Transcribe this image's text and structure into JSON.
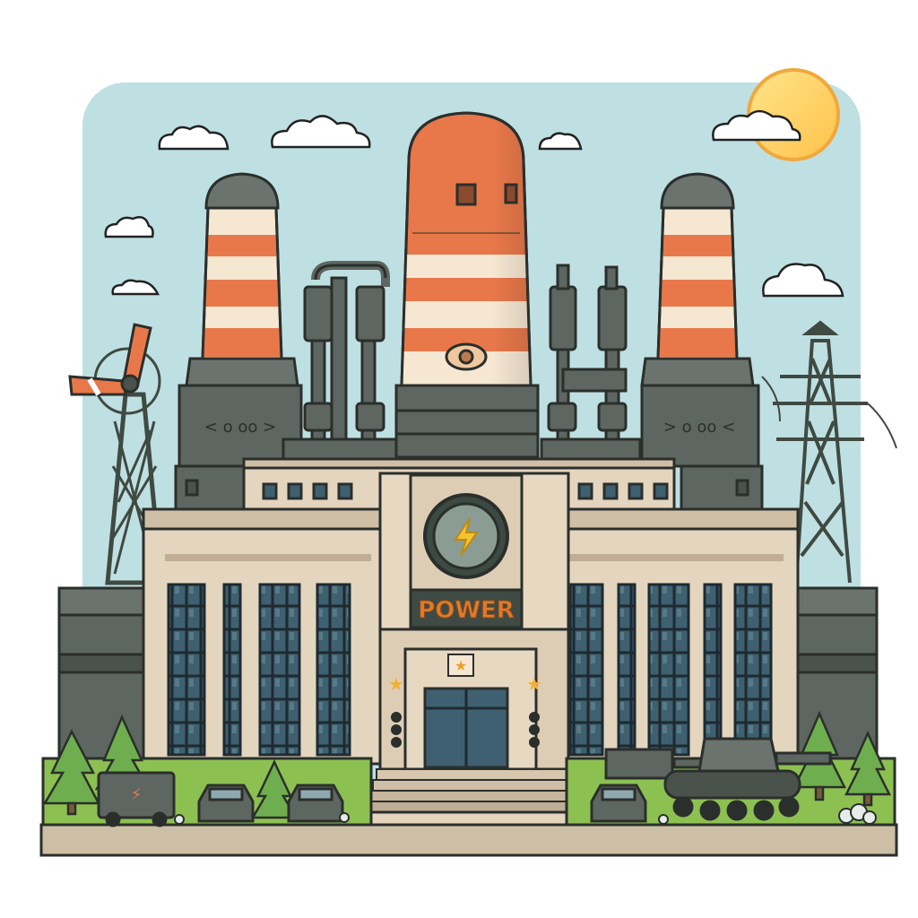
{
  "building": {
    "sign_text": "POWER",
    "emblem": "lightning-bolt-icon"
  },
  "colors": {
    "sky": "#bfe0e2",
    "tower_orange": "#e8784a",
    "tower_cream": "#f6e7d2",
    "concrete_dark": "#5d6660",
    "facade": "#e4d5bf",
    "window": "#3d5d6a",
    "grass": "#8cc152",
    "sun": "#ffd46b",
    "sign_text": "#e07b2b"
  }
}
